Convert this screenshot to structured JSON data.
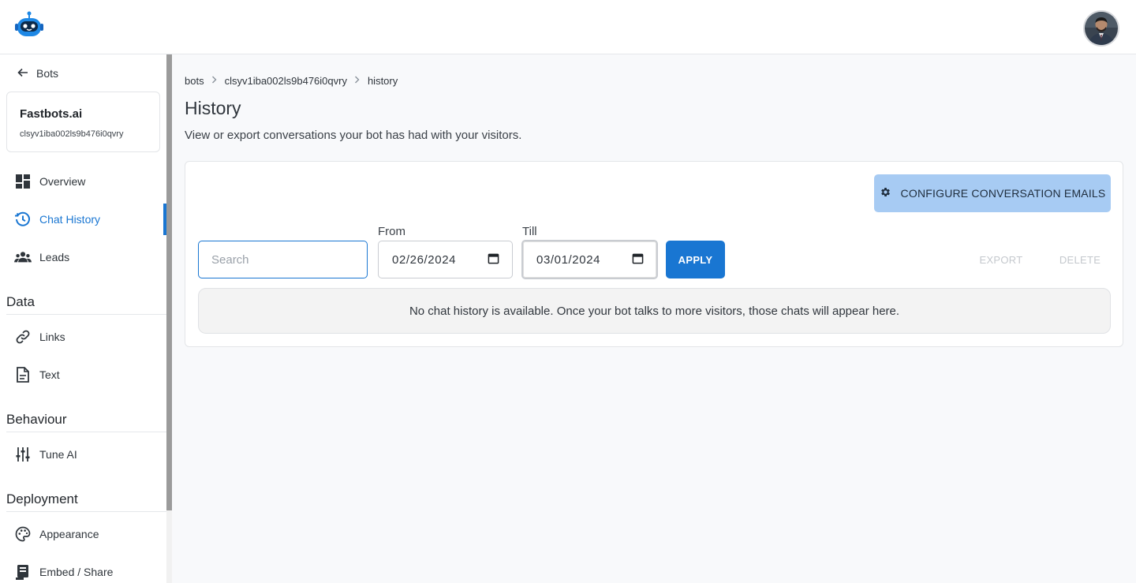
{
  "header": {
    "logo_icon": "robot-logo-icon",
    "avatar_icon": "user-avatar"
  },
  "sidebar": {
    "back_label": "Bots",
    "bot": {
      "name": "Fastbots.ai",
      "id": "clsyv1iba002ls9b476i0qvry"
    },
    "main_items": [
      {
        "label": "Overview",
        "icon": "dashboard-icon"
      },
      {
        "label": "Chat History",
        "icon": "history-icon",
        "active": true
      },
      {
        "label": "Leads",
        "icon": "people-icon"
      }
    ],
    "sections": [
      {
        "title": "Data",
        "items": [
          {
            "label": "Links",
            "icon": "link-icon"
          },
          {
            "label": "Text",
            "icon": "text-document-icon"
          }
        ]
      },
      {
        "title": "Behaviour",
        "items": [
          {
            "label": "Tune AI",
            "icon": "sliders-icon"
          }
        ]
      },
      {
        "title": "Deployment",
        "items": [
          {
            "label": "Appearance",
            "icon": "palette-icon"
          },
          {
            "label": "Embed / Share",
            "icon": "embed-icon"
          }
        ]
      }
    ]
  },
  "breadcrumb": {
    "items": [
      "bots",
      "clsyv1iba002ls9b476i0qvry",
      "history"
    ]
  },
  "page": {
    "title": "History",
    "subtitle": "View or export conversations your bot has had with your visitors."
  },
  "panel": {
    "configure_label": "CONFIGURE CONVERSATION EMAILS",
    "search_placeholder": "Search",
    "from_label": "From",
    "from_value": "02/26/2024",
    "till_label": "Till",
    "till_value": "03/01/2024",
    "apply_label": "APPLY",
    "export_label": "EXPORT",
    "delete_label": "DELETE",
    "empty_message": "No chat history is available. Once your bot talks to more visitors, those chats will appear here."
  },
  "colors": {
    "primary": "#1976d2",
    "config_button": "#a7cbf3",
    "page_bg": "#f8f9fb"
  }
}
